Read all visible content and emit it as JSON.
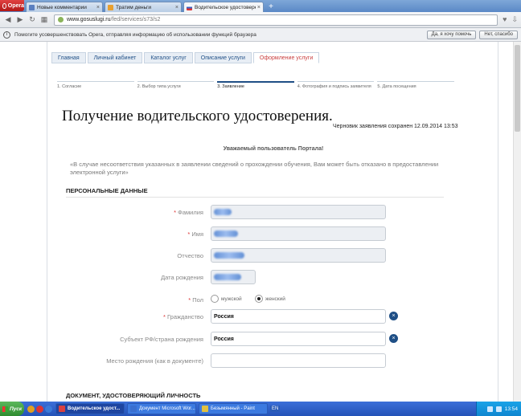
{
  "browser": {
    "menu_label": "Opera",
    "tabs": [
      {
        "label": "Новые комментарии",
        "color": "#5a7fc0",
        "active": false
      },
      {
        "label": "Тратим деньги",
        "color": "#e8a030",
        "active": false
      },
      {
        "label": "Водительское удостоверение",
        "color": "#d84040",
        "active": true
      }
    ],
    "url_host": "www.gosuslugi.ru",
    "url_path": "/fed/services/s73/s2",
    "notification": "Помогите усовершенствовать Opera, отправляя информацию об использовании функций браузера",
    "notif_yes": "Да, я хочу помочь",
    "notif_no": "Нет, спасибо"
  },
  "nav": {
    "crumbs": [
      "Главная",
      "Личный кабинет",
      "Каталог услуг",
      "Описание услуги",
      "Оформление услуги"
    ]
  },
  "steps": [
    "1. Согласие",
    "2. Выбор типа услуги",
    "3. Заявление",
    "4. Фотография и подпись заявителя",
    "5. Дата посещения"
  ],
  "page": {
    "title": "Получение водительского удостоверения.",
    "draft_status": "Черновик заявления сохранен 12.09.2014 13:53",
    "greeting": "Уважаемый пользователь Портала!",
    "warning": "«В случае несоответствия указанных в заявлении сведений о прохождении обучения, Вам может быть отказано в предоставлении электронной услуги»",
    "section_personal": "ПЕРСОНАЛЬНЫЕ ДАННЫЕ",
    "section_document": "ДОКУМЕНТ, УДОСТОВЕРЯЮЩИЙ ЛИЧНОСТЬ"
  },
  "form": {
    "required_mark": "*",
    "surname_label": "Фамилия",
    "name_label": "Имя",
    "patronymic_label": "Отчество",
    "birthdate_label": "Дата рождения",
    "gender_label": "Пол",
    "gender_male": "мужской",
    "gender_female": "женский",
    "gender_selected": "женский",
    "citizenship_label": "Гражданство",
    "citizenship_value": "Россия",
    "region_label": "Субъект РФ/страна рождения",
    "region_value": "Россия",
    "birthplace_label": "Место рождения (как в документе)",
    "birthplace_value": ""
  },
  "taskbar": {
    "start_label": "Пуск",
    "items": [
      {
        "label": "Водительское удост...",
        "color": "#d84040",
        "active": true
      },
      {
        "label": "Документ Microsoft Wor...",
        "color": "#3a6fd0",
        "active": false
      },
      {
        "label": "Безымянный - Paint",
        "color": "#e0c040",
        "active": false
      }
    ],
    "lang": "EN",
    "time": "13:54"
  }
}
